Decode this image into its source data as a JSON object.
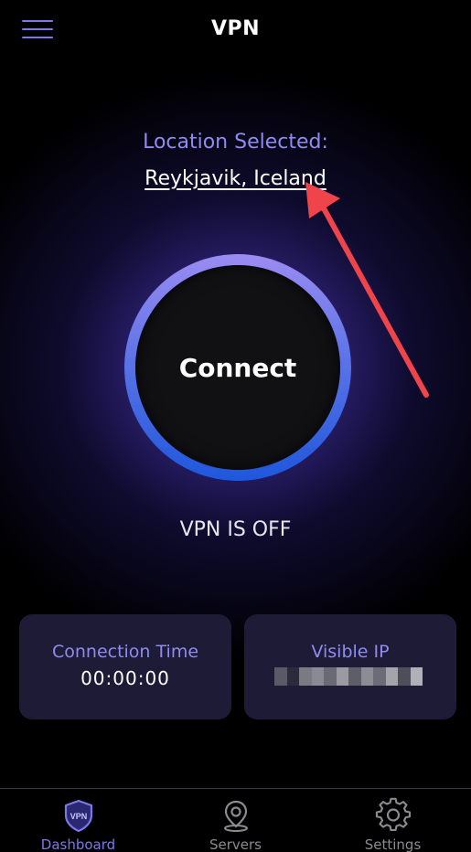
{
  "header": {
    "title": "VPN",
    "menu_icon": "hamburger-menu-icon"
  },
  "location": {
    "label": "Location Selected:",
    "value": "Reykjavik, Iceland"
  },
  "connect": {
    "label": "Connect"
  },
  "status": {
    "text": "VPN IS OFF"
  },
  "cards": {
    "connection_time": {
      "title": "Connection Time",
      "value": "00:00:00"
    },
    "visible_ip": {
      "title": "Visible IP"
    }
  },
  "tabbar": {
    "tabs": [
      {
        "label": "Dashboard",
        "icon": "vpn-shield-icon",
        "active": true
      },
      {
        "label": "Servers",
        "icon": "location-pin-icon",
        "active": false
      },
      {
        "label": "Settings",
        "icon": "gear-icon",
        "active": false
      }
    ]
  },
  "colors": {
    "accent": "#7b78e8",
    "label_purple": "#8f8bf0",
    "annotation_arrow": "#f0444b",
    "card_bg": "#1d1b36"
  }
}
